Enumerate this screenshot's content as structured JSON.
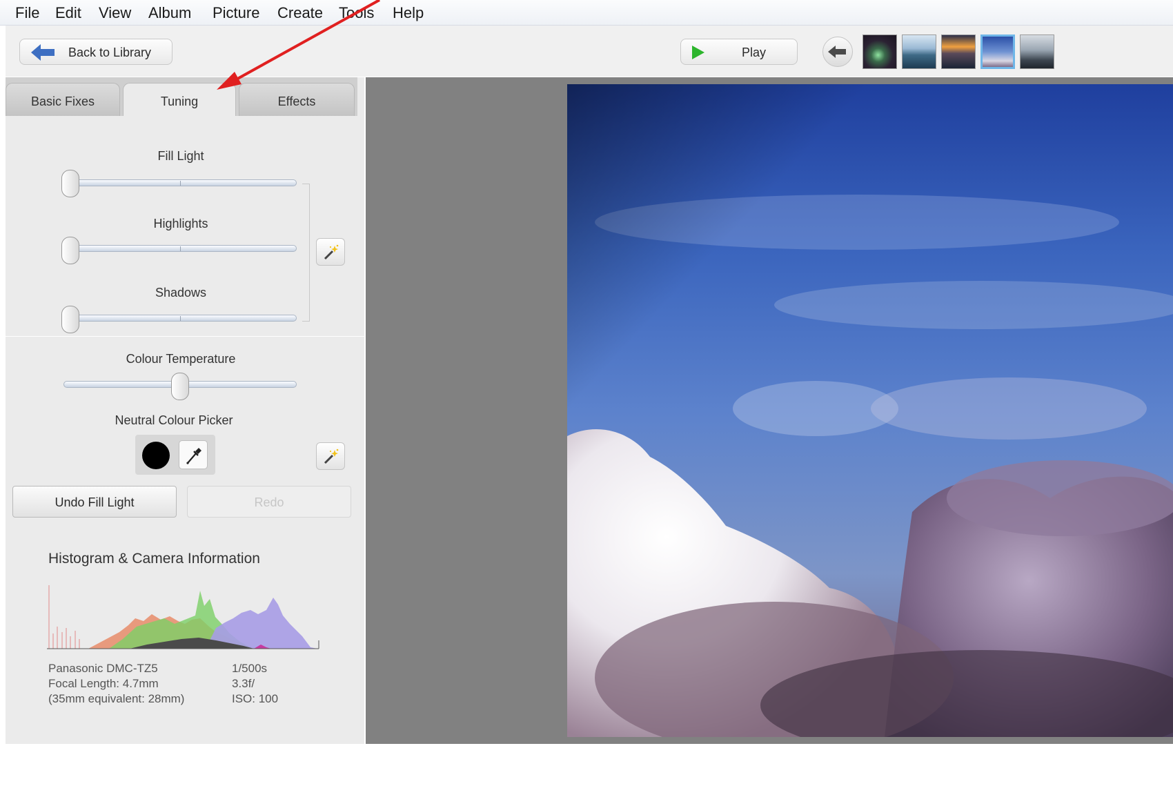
{
  "menu": [
    "File",
    "Edit",
    "View",
    "Album",
    "Picture",
    "Create",
    "Tools",
    "Help"
  ],
  "toolbar": {
    "back_label": "Back to Library",
    "play_label": "Play",
    "thumbnails": [
      "aurora-thumbnail",
      "sea-thumbnail",
      "sunset-thumbnail",
      "sky-thumbnail",
      "cliff-thumbnail"
    ],
    "selected_thumbnail": 3
  },
  "tabs": {
    "basic": "Basic Fixes",
    "tuning": "Tuning",
    "effects": "Effects",
    "active": "Tuning"
  },
  "sliders": {
    "fill_light": {
      "label": "Fill Light",
      "value": 0
    },
    "highlights": {
      "label": "Highlights",
      "value": 0
    },
    "shadows": {
      "label": "Shadows",
      "value": 0
    },
    "colour_temperature": {
      "label": "Colour Temperature",
      "value": 0.5
    }
  },
  "neutral_picker": {
    "label": "Neutral Colour Picker",
    "swatch_color": "#000000"
  },
  "actions": {
    "undo_label": "Undo Fill Light",
    "redo_label": "Redo"
  },
  "histogram": {
    "title": "Histogram & Camera Information",
    "camera": "Panasonic DMC-TZ5",
    "focal_length": "Focal Length: 4.7mm",
    "equivalent": "(35mm equivalent:  28mm)",
    "shutter": "1/500s",
    "aperture": "3.3f/",
    "iso": "ISO: 100"
  },
  "icons": {
    "back": "left-arrow-icon",
    "play": "play-icon",
    "prev": "previous-arrow-icon",
    "auto": "magic-wand-icon",
    "picker": "eyedropper-icon"
  },
  "colors": {
    "annotation_arrow": "#e02020",
    "play_green": "#2db52d",
    "back_arrow_blue": "#3e6fc2",
    "viewer_gray": "#818181"
  }
}
